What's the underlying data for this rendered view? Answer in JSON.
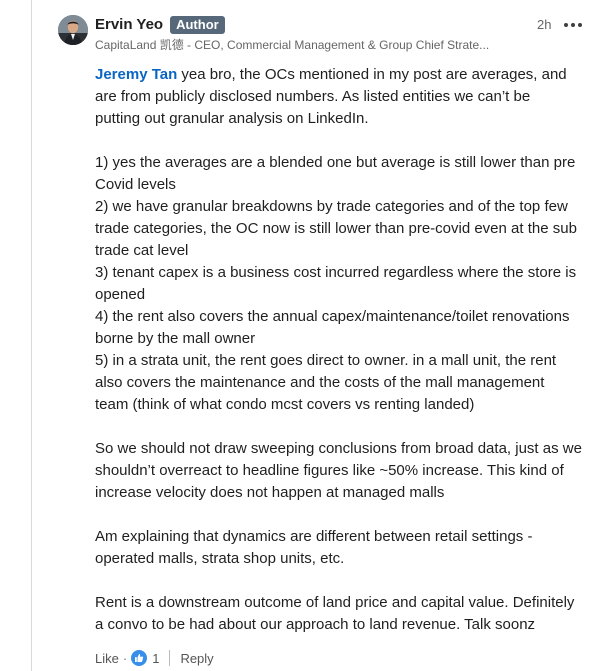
{
  "comment": {
    "author": {
      "name": "Ervin Yeo",
      "badge": "Author",
      "headline": "CapitaLand 凯德 - CEO, Commercial Management & Group Chief Strate..."
    },
    "timestamp": "2h",
    "mention": "Jeremy Tan",
    "body_first_line_rest": " yea bro, the OCs mentioned in my post are averages, and",
    "paragraphs": [
      {
        "lines": [
          "are from publicly disclosed numbers. As listed entities we can’t be",
          "putting out granular analysis on LinkedIn."
        ]
      },
      {
        "lines": [
          "1) yes the averages are a blended one but average is still lower than pre",
          "Covid levels",
          "2) we have granular breakdowns by trade categories and of the top few",
          "trade categories, the OC now is still lower than pre-covid even at the sub",
          "trade cat level",
          "3) tenant capex is a business cost incurred regardless where the store is",
          "opened",
          "4) the rent also covers the annual capex/maintenance/toilet renovations",
          "borne by the mall owner",
          "5) in a strata unit, the rent goes direct to owner. in a mall unit, the rent",
          "also covers the maintenance and the costs of the mall management",
          "team (think of what condo mcst covers vs renting landed)"
        ]
      },
      {
        "lines": [
          "So we should not draw sweeping conclusions from broad data, just as we",
          "shouldn’t overreact to headline figures like ~50% increase. This kind of",
          "increase velocity does not happen at managed malls"
        ]
      },
      {
        "lines": [
          "Am explaining that dynamics are different between retail settings -",
          "operated malls, strata shop units, etc."
        ]
      },
      {
        "lines": [
          "Rent is a downstream outcome of land price and capital value. Definitely",
          "a convo to be had about our approach to land revenue. Talk soonz"
        ]
      }
    ],
    "actions": {
      "like_label": "Like",
      "dot": "·",
      "reaction_count": "1",
      "reply_label": "Reply"
    }
  },
  "colors": {
    "mention": "#0a66c2",
    "badge_bg": "#56687a",
    "reaction": "#378fe9"
  },
  "icons": {
    "more": "more-horizontal-icon",
    "reaction": "thumbs-up-reaction-icon"
  }
}
